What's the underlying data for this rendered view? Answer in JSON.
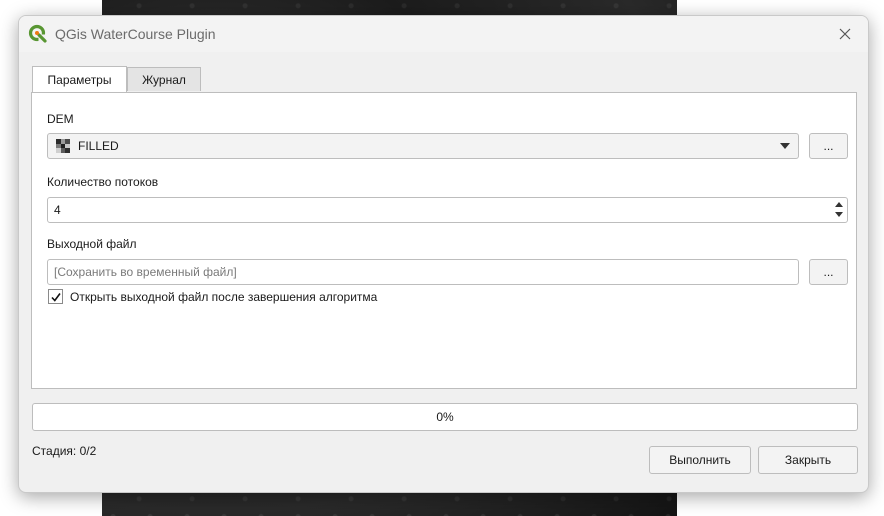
{
  "window": {
    "title": "QGis WaterCourse Plugin"
  },
  "tabs": [
    {
      "label": "Параметры",
      "active": true
    },
    {
      "label": "Журнал",
      "active": false
    }
  ],
  "params": {
    "dem_label": "DEM",
    "dem_value": "FILLED",
    "browse_label": "...",
    "threads_label": "Количество потоков",
    "threads_value": "4",
    "output_label": "Выходной файл",
    "output_placeholder": "[Сохранить во временный файл]",
    "open_after_label": "Открыть выходной файл после завершения алгоритма",
    "open_after_checked": true
  },
  "progress": {
    "value": 0,
    "label": "0%"
  },
  "footer": {
    "stage_text": "Стадия: 0/2",
    "run_label": "Выполнить",
    "close_label": "Закрыть"
  },
  "icons": {
    "app": "qgis-logo-icon",
    "close": "close-icon",
    "dem": "raster-layer-icon",
    "combo_arrow": "chevron-down-icon",
    "checkbox": "checkmark-icon"
  },
  "colors": {
    "qgis_green": "#589632",
    "qgis_yellow": "#ee7913"
  }
}
